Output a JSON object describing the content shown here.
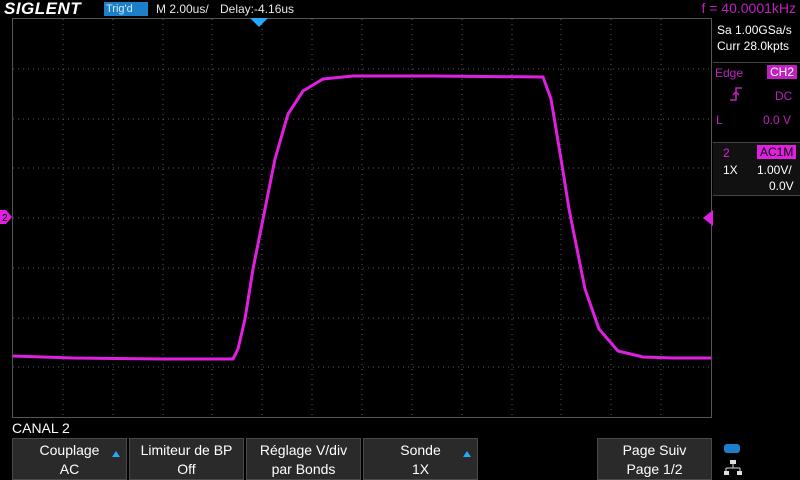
{
  "header": {
    "brand": "SIGLENT",
    "trigger_status": "Trig'd",
    "timebase": "M 2.00us/",
    "delay": "Delay:-4.16us",
    "frequency": "f = 40.0001kHz"
  },
  "acquisition": {
    "sample_rate": "Sa 1.00GSa/s",
    "memory_depth": "Curr 28.0kpts"
  },
  "trigger": {
    "type": "Edge",
    "source": "CH2",
    "coupling": "DC",
    "level_label": "L",
    "level": "0.0 V"
  },
  "channel": {
    "number": "2",
    "coupling_impedance": "AC1M",
    "probe": "1X",
    "vdiv": "1.00V/",
    "offset": "0.0V"
  },
  "menu": {
    "title": "CANAL 2",
    "buttons": [
      {
        "line1": "Couplage",
        "line2": "AC"
      },
      {
        "line1": "Limiteur de BP",
        "line2": "Off"
      },
      {
        "line1": "Réglage V/div",
        "line2": "par Bonds"
      },
      {
        "line1": "Sonde",
        "line2": "1X"
      },
      {
        "line1": "Page Suiv",
        "line2": "Page 1/2"
      }
    ]
  },
  "markers": {
    "channel_marker": "2"
  },
  "colors": {
    "trace": "#e020e0",
    "accent": "#1d7fc9",
    "grid": "#5a5a5a"
  }
}
